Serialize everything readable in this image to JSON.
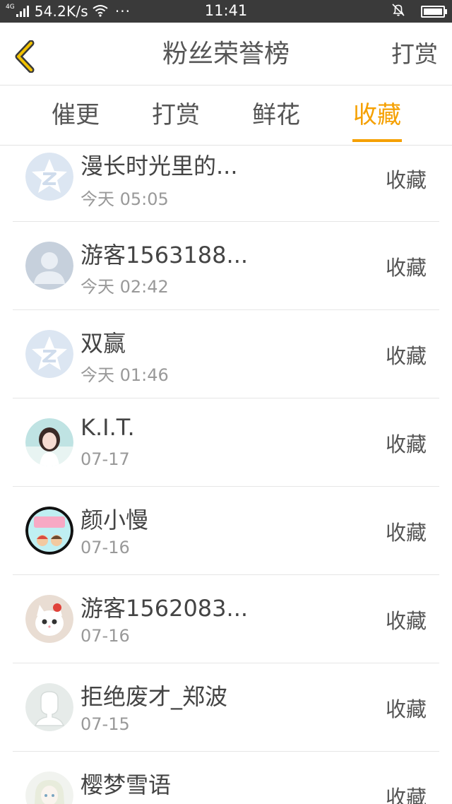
{
  "status_bar": {
    "network": "4G",
    "speed": "54.2K/s",
    "dots": "···",
    "time": "11:41"
  },
  "header": {
    "title": "粉丝荣誉榜",
    "right_link": "打赏"
  },
  "tabs": [
    {
      "label": "催更",
      "active": false
    },
    {
      "label": "打赏",
      "active": false
    },
    {
      "label": "鲜花",
      "active": false
    },
    {
      "label": "收藏",
      "active": true
    }
  ],
  "colors": {
    "accent": "#f5a000",
    "status_bar": "#3a3a3a",
    "text": "#555555",
    "subtext": "#999999"
  },
  "list": [
    {
      "name": "漫长时光里的...",
      "time": "今天 05:05",
      "action": "收藏",
      "avatar": "qq-star-icon"
    },
    {
      "name": "游客1563188...",
      "time": "今天 02:42",
      "action": "收藏",
      "avatar": "default-person-icon"
    },
    {
      "name": "双赢",
      "time": "今天 01:46",
      "action": "收藏",
      "avatar": "qq-star-icon"
    },
    {
      "name": "K.I.T.",
      "time": "07-17",
      "action": "收藏",
      "avatar": "girl-photo"
    },
    {
      "name": "颜小慢",
      "time": "07-16",
      "action": "收藏",
      "avatar": "cartoon-photo"
    },
    {
      "name": "游客1562083...",
      "time": "07-16",
      "action": "收藏",
      "avatar": "cat-photo"
    },
    {
      "name": "拒绝废才_郑波",
      "time": "07-15",
      "action": "收藏",
      "avatar": "outline-person-icon"
    },
    {
      "name": "樱梦雪语",
      "time": "",
      "action": "收藏",
      "avatar": "anime-photo"
    }
  ]
}
